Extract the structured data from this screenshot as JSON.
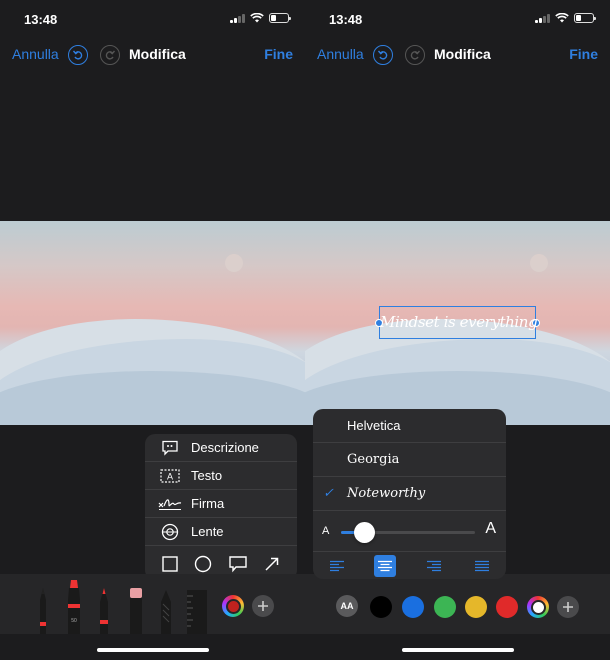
{
  "left": {
    "status": {
      "time": "13:48"
    },
    "nav": {
      "cancel": "Annulla",
      "title": "Modifica",
      "done": "Fine"
    },
    "menu": {
      "items": [
        {
          "label": "Descrizione",
          "icon": "speech-bubble-icon"
        },
        {
          "label": "Testo",
          "icon": "text-box-icon"
        },
        {
          "label": "Firma",
          "icon": "signature-icon"
        },
        {
          "label": "Lente",
          "icon": "magnifier-icon"
        }
      ],
      "shapes": [
        "square-icon",
        "circle-icon",
        "speech-bubble-icon",
        "arrow-icon"
      ]
    },
    "tools": [
      "pen-icon",
      "marker-icon",
      "pencil-icon",
      "eraser-icon",
      "lasso-icon",
      "ruler-icon",
      "color-picker-icon",
      "add-icon"
    ],
    "pen_label": "50"
  },
  "right": {
    "status": {
      "time": "13:48"
    },
    "nav": {
      "cancel": "Annulla",
      "title": "Modifica",
      "done": "Fine"
    },
    "annotation_text": "Mindset is everything",
    "fonts": {
      "options": [
        "Helvetica",
        "Georgia",
        "Noteworthy"
      ],
      "selected": "Noteworthy"
    },
    "size": {
      "small_label": "A",
      "large_label": "A",
      "value_fraction": 0.17
    },
    "alignment": {
      "options": [
        "align-left-icon",
        "align-center-icon",
        "align-right-icon",
        "align-justify-icon"
      ],
      "selected": "align-center-icon"
    },
    "toolbar": {
      "font_button": "AA",
      "colors": [
        "#000000",
        "#1a6fe0",
        "#3cb554",
        "#e5b72a",
        "#e02a2a"
      ],
      "selected_color": "#ffffff"
    }
  },
  "colors": {
    "accent": "#2f7fe0",
    "background": "#1c1c1e",
    "panel": "#2c2c2e",
    "toolbar": "#262628"
  }
}
